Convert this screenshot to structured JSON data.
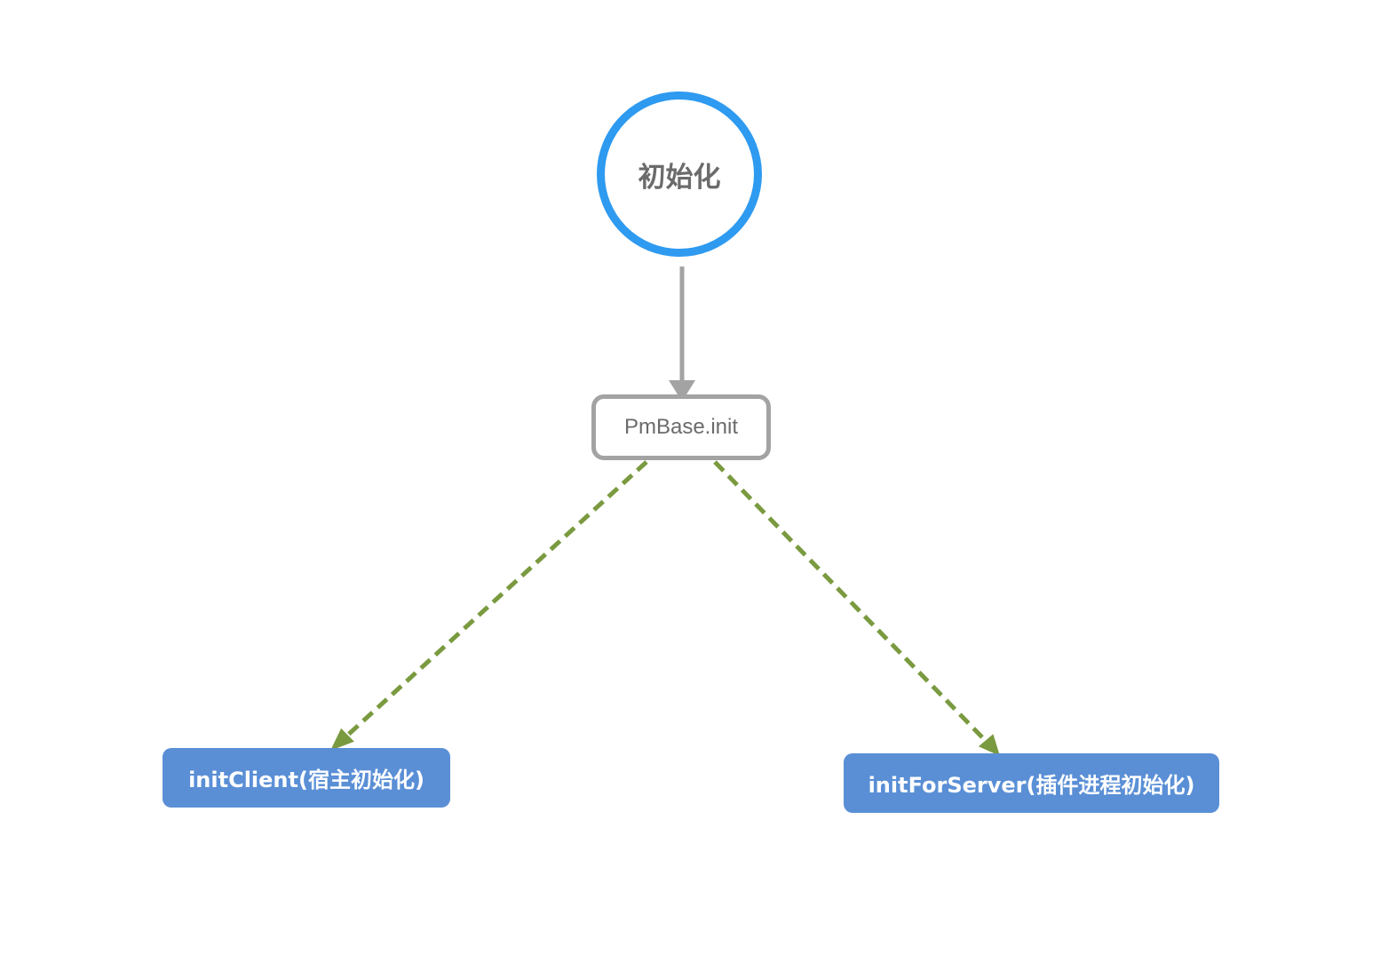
{
  "nodes": {
    "start": {
      "label": "初始化"
    },
    "process": {
      "label": "PmBase.init"
    },
    "client": {
      "label": "initClient(宿主初始化)"
    },
    "server": {
      "label": "initForServer(插件进程初始化)"
    }
  },
  "edges": [
    {
      "from": "start",
      "to": "process",
      "style": "solid"
    },
    {
      "from": "process",
      "to": "client",
      "style": "dashed"
    },
    {
      "from": "process",
      "to": "server",
      "style": "dashed"
    }
  ],
  "colors": {
    "start_border": "#2e9af0",
    "process_border": "#a3a3a3",
    "target_fill": "#5a8fd6",
    "solid_edge": "#a3a3a3",
    "dashed_edge": "#7a9a40",
    "label_text": "#6b6b6b"
  }
}
